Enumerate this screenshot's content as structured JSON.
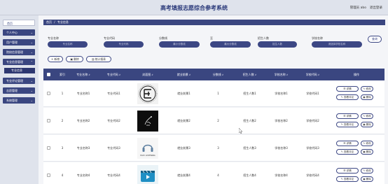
{
  "app": {
    "title": "高考填报志愿综合参考系统",
    "user_label": "管理员 abo",
    "logout_label": "退出登录"
  },
  "sidebar": {
    "items": [
      {
        "label": "首页",
        "chevron": ""
      },
      {
        "label": "个人中心",
        "chevron": "⌄"
      },
      {
        "label": "用户管理",
        "chevron": "⌄"
      },
      {
        "label": "院校信息管理",
        "chevron": "⌄"
      },
      {
        "label": "专业信息管理",
        "chevron": "⌃"
      },
      {
        "label": "专业信息",
        "chevron": ""
      },
      {
        "label": "专业评论管理",
        "chevron": "⌄"
      },
      {
        "label": "志愿管理",
        "chevron": "⌄"
      },
      {
        "label": "系统管理",
        "chevron": "⌄"
      }
    ]
  },
  "breadcrumb": {
    "home": "首页",
    "separator": "/",
    "current": "专业信息"
  },
  "filters": [
    {
      "label": "专业名称",
      "placeholder": "专业名称"
    },
    {
      "label": "专业代码",
      "placeholder": "专业代码"
    },
    {
      "label": "分数线",
      "placeholder": "最小分数线"
    },
    {
      "label": "至",
      "placeholder": "最大分数线"
    },
    {
      "label": "招生人数",
      "placeholder": "招生人数"
    },
    {
      "label": "学校名称",
      "placeholder": "请选择学校名称"
    }
  ],
  "search_label": "查询",
  "actions": {
    "add": "新增",
    "delete": "删除",
    "report": "统计报表"
  },
  "table": {
    "headers": [
      "索引",
      "专业名称",
      "专业代码",
      "封面图",
      "就业前景",
      "分数线",
      "招生人数",
      "学校名称",
      "学校代码",
      "操作"
    ],
    "rows": [
      {
        "index": "1",
        "name": "专业名称1",
        "code": "专业代码1",
        "outlook": "就业前景1",
        "score": "1",
        "enroll": "招生人数1",
        "school": "学校名称1",
        "school_code": "学校代码1"
      },
      {
        "index": "2",
        "name": "专业名称2",
        "code": "专业代码2",
        "outlook": "就业前景2",
        "score": "2",
        "enroll": "招生人数2",
        "school": "学校名称2",
        "school_code": "学校代码2"
      },
      {
        "index": "3",
        "name": "专业名称3",
        "code": "专业代码3",
        "outlook": "就业前景3",
        "score": "3",
        "enroll": "招生人数3",
        "school": "学校名称3",
        "school_code": "学校代码3"
      },
      {
        "index": "4",
        "name": "专业名称4",
        "code": "专业代码4",
        "outlook": "就业前景4",
        "score": "4",
        "enroll": "招生人数4",
        "school": "学校名称4",
        "school_code": "学校代码4"
      }
    ],
    "row_buttons": {
      "detail": "详情",
      "edit": "修改",
      "review": "查看评论",
      "delete": "删除"
    }
  },
  "thumb_text": {
    "row3": "EASY LISTENING"
  },
  "colors": {
    "primary": "#3a4680",
    "sidebar_bg": "#dfe3ec",
    "page_bg": "#f4f5f8"
  }
}
